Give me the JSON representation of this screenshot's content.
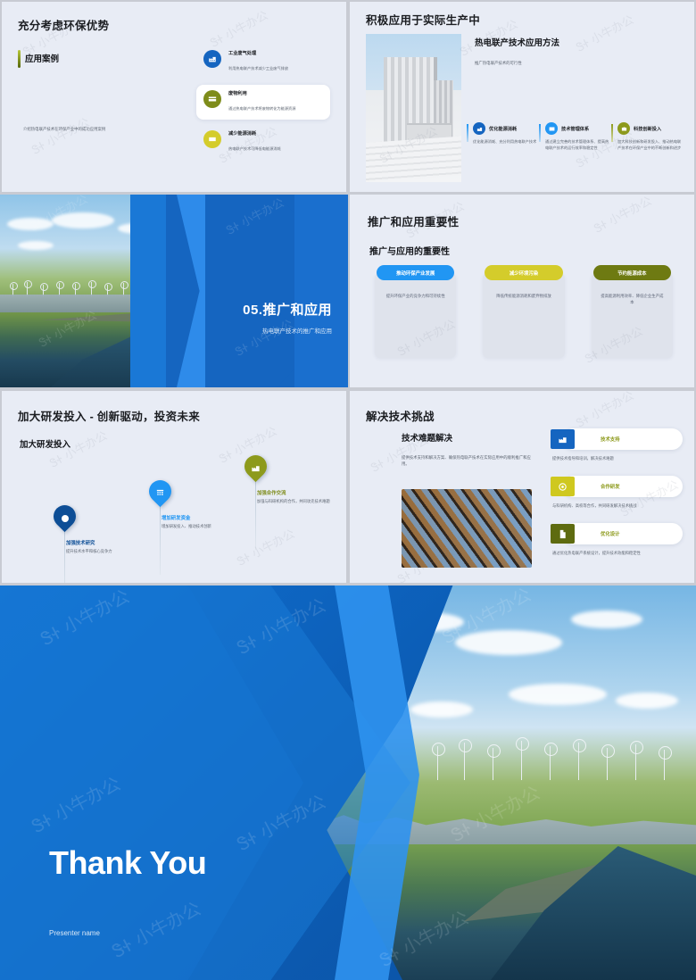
{
  "slides": [
    {
      "id": "slide-eco-advantages",
      "title": "充分考虑环保优势",
      "section_label": "应用案例",
      "footnote": "介绍热电联产技术在环保产业中的成功应用案例",
      "features": [
        {
          "title": "工业废气处理",
          "desc": "利用热电联产技术减少工业废气排放",
          "icon": "factory-icon",
          "color": "#1565C0",
          "highlighted": false
        },
        {
          "title": "废物利用",
          "desc": "通过热电联产技术将废物转化为能源资源",
          "icon": "recycle-icon",
          "color": "#7E8C1A",
          "highlighted": true
        },
        {
          "title": "减少能源消耗",
          "desc": "热电联产技术可降低电能源消耗",
          "icon": "energy-icon",
          "color": "#D4CC2B",
          "highlighted": false
        }
      ]
    },
    {
      "id": "slide-practical-application",
      "title": "积极应用于实际生产中",
      "heading": "热电联产技术应用方法",
      "lead": "推广热电联产技术的可行性",
      "image_alt": "industrial-building-photo",
      "columns": [
        {
          "title": "优化能源消耗",
          "desc": "优化能源消耗、充分利用热电联产技术",
          "icon": "factory-icon",
          "color": "#1565C0",
          "rule": "blue"
        },
        {
          "title": "技术管理体系",
          "desc": "通过建立完善的技术管理体系、提高热电联产技术的运行效率和稳定性",
          "icon": "mail-icon",
          "color": "#2196F3",
          "rule": "blue"
        },
        {
          "title": "科技创新投入",
          "desc": "加大科技创新和研发投入、推动热电联产技术在环保产业中的不断创新和进步",
          "icon": "briefcase-icon",
          "color": "#8D9A1C",
          "rule": "green"
        }
      ]
    },
    {
      "id": "slide-section-divider",
      "number_title": "05.推广和应用",
      "subtitle": "热电联产技术的推广和应用",
      "image_alt": "wind-farm-aerial-photo"
    },
    {
      "id": "slide-importance",
      "title": "推广和应用重要性",
      "heading": "推广与应用的重要性",
      "cards": [
        {
          "pill": "推动环保产业发展",
          "desc": "提升环保产业的竞争力和可持续性",
          "color": "#2196F3"
        },
        {
          "pill": "减少环境污染",
          "desc": "降低传统能源消耗和废弃物排放",
          "color": "#D4CC2B"
        },
        {
          "pill": "节约能源成本",
          "desc": "提高能源利用效率、降低企业生产成本",
          "color": "#6E7A12"
        }
      ]
    },
    {
      "id": "slide-rnd-investment",
      "title": "加大研发投入 - 创新驱动，投资未来",
      "heading": "加大研发投入",
      "nodes": [
        {
          "title": "加强技术研究",
          "desc": "提升技术水平和核心竞争力",
          "icon": "target-icon",
          "color": "#0D4E96",
          "title_color": "#0D4E96"
        },
        {
          "title": "增加研发资金",
          "desc": "增加研发投入、推动技术创新",
          "icon": "chart-icon",
          "color": "#2196F3",
          "title_color": "#2196F3"
        },
        {
          "title": "加强合作交流",
          "desc": "加强与科研机构的合作，共同攻克技术难题",
          "icon": "factory-icon",
          "color": "#8D9A1C",
          "title_color": "#7E8C1A"
        }
      ]
    },
    {
      "id": "slide-tech-challenges",
      "title": "解决技术挑战",
      "heading": "技术难题解决",
      "lead": "提供技术支持和解决方案、确保热电联产技术在实际应用中的顺利推广和应用。",
      "image_alt": "glass-facade-photo",
      "items": [
        {
          "title": "技术支持",
          "desc": "提供技术指导和培训，解决技术难题",
          "icon": "factory-icon",
          "color": "#1565C0",
          "title_color": "#8D9A1C"
        },
        {
          "title": "合作研发",
          "desc": "与科研机构、高校等合作，共同研发解决技术挑战",
          "icon": "target-icon",
          "color": "#CFC81F",
          "title_color": "#8D9A1C"
        },
        {
          "title": "优化设计",
          "desc": "通过优化热电联产系统设计，提升技术效能和稳定性",
          "icon": "document-icon",
          "color": "#5E6B10",
          "title_color": "#8D9A1C"
        }
      ]
    },
    {
      "id": "slide-thank-you",
      "thank_you": "Thank You",
      "presenter": "Presenter name",
      "image_alt": "wind-farm-aerial-photo"
    }
  ],
  "watermark": {
    "text": "小牛办公"
  },
  "colors": {
    "slide_bg": "#e8ecf5",
    "gutter": "#c8cbd3",
    "accent_blue": "#1565C0",
    "accent_light_blue": "#2196F3",
    "accent_olive": "#8D9A1C",
    "accent_yellow": "#D4CC2B",
    "title_text": "#1b1d21",
    "body_text": "#5d6571"
  }
}
